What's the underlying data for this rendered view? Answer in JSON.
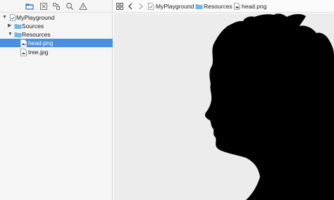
{
  "sidebar": {
    "navigator_icons": [
      "folder-icon",
      "source-control-icon",
      "symbol-icon",
      "search-icon",
      "warning-icon"
    ],
    "tree": [
      {
        "label": "MyPlayground",
        "icon": "playground-file-icon",
        "disclosure": "expanded"
      },
      {
        "label": "Sources",
        "icon": "folder-icon",
        "disclosure": "collapsed"
      },
      {
        "label": "Resources",
        "icon": "folder-icon",
        "disclosure": "expanded"
      },
      {
        "label": "head.png",
        "icon": "image-file-icon",
        "disclosure": "none",
        "selected": true
      },
      {
        "label": "tree.jpg",
        "icon": "image-file-icon",
        "disclosure": "none"
      }
    ]
  },
  "jump_bar": {
    "icons": [
      "grid-icon",
      "back-arrow-icon",
      "forward-arrow-icon"
    ],
    "crumbs": [
      "MyPlayground",
      "Resources",
      "head.png"
    ]
  },
  "colors": {
    "selection": "#4a90e2",
    "accent": "#3478d4",
    "folder": "#6fb7ec",
    "canvas_bg": "#ececec",
    "silhouette": "#000000"
  },
  "editor": {
    "image": "woman-head-silhouette"
  }
}
